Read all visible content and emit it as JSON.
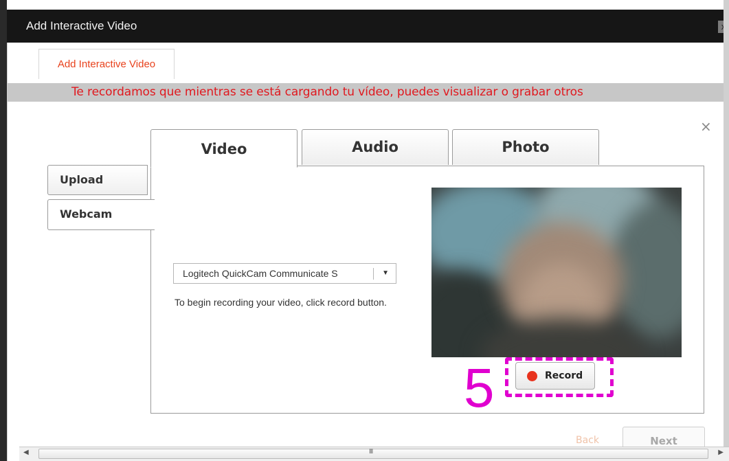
{
  "window": {
    "title": "Add Interactive Video",
    "close_glyph": "x"
  },
  "outer_tab": {
    "label": "Add Interactive Video"
  },
  "notice": {
    "text": "Te recordamos que mientras se está cargando tu vídeo, puedes visualizar o grabar otros"
  },
  "panel_close": "×",
  "media_tabs": [
    {
      "label": "Video",
      "active": true
    },
    {
      "label": "Audio",
      "active": false
    },
    {
      "label": "Photo",
      "active": false
    }
  ],
  "source_tabs": [
    {
      "label": "Upload",
      "active": false
    },
    {
      "label": "Webcam",
      "active": true
    }
  ],
  "camera_select": {
    "value": "Logitech QuickCam Communicate S",
    "arrow": "▼"
  },
  "instruction": "To begin recording your video, click record button.",
  "record_button": {
    "label": "Record"
  },
  "annotation": {
    "number": "5",
    "color": "#e000cf"
  },
  "footer": {
    "back_label": "Back",
    "next_label": "Next"
  },
  "scrollbar": {
    "left_arrow": "◀",
    "right_arrow": "▶",
    "grip": "III"
  },
  "colors": {
    "notice_text": "#e0191f",
    "outer_tab_text": "#e8421d",
    "record_dot": "#e8331e"
  }
}
